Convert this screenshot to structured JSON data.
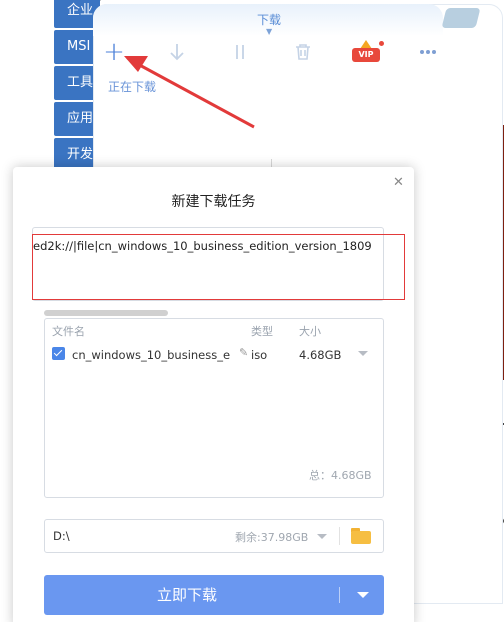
{
  "background": {
    "side_buttons": [
      "企业",
      "MSI",
      "工具",
      "应用",
      "开发"
    ]
  },
  "panel": {
    "title": "下载",
    "toolbar": {
      "add_icon": "plus-icon",
      "download_icon": "arrow-down-icon",
      "pause_icon": "pause-icon",
      "delete_icon": "trash-icon",
      "vip_label": "VIP",
      "more_icon": "more-horizontal-icon"
    },
    "tab_downloading": "正在下载"
  },
  "dialog": {
    "title": "新建下载任务",
    "close_icon": "close-icon",
    "url_value": "ed2k://|file|cn_windows_10_business_edition_version_1809",
    "file_table": {
      "headers": [
        "文件名",
        "类型",
        "大小"
      ],
      "rows": [
        {
          "checked": true,
          "name": "cn_windows_10_business_e",
          "type": "iso",
          "size": "4.68GB"
        }
      ],
      "total": "总：4.68GB"
    },
    "save_path": {
      "value": "D:\\",
      "remaining": "剩余:37.98GB",
      "folder_icon": "folder-icon"
    },
    "download_button": {
      "label": "立即下载",
      "dropdown_icon": "caret-down-icon"
    }
  },
  "colors": {
    "accent": "#4a7fd8",
    "download_button": "#6a97f0",
    "annotation": "#e23a3a",
    "vip": "#e8483b"
  }
}
